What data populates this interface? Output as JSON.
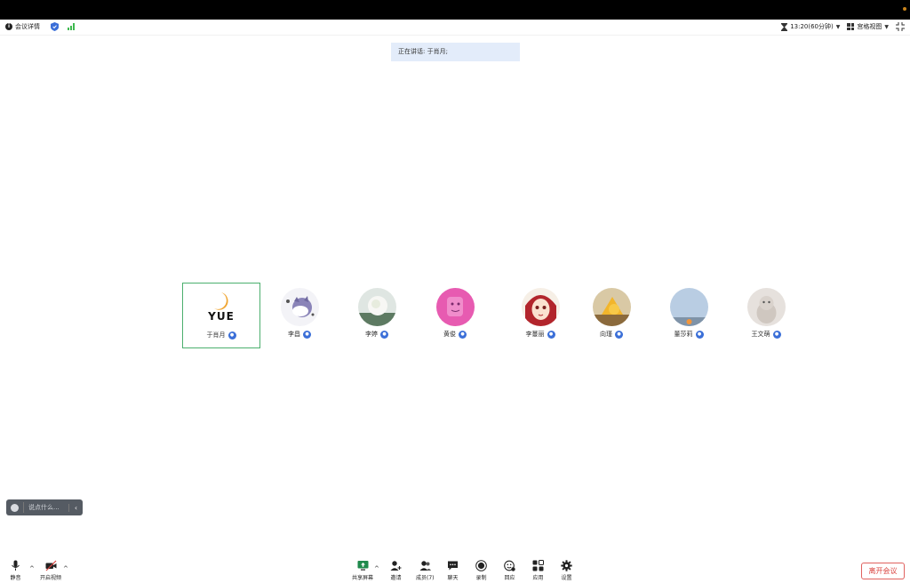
{
  "topbar": {
    "meeting_info_label": "会议详情",
    "timer_label": "13:20(60分钟)",
    "view_label": "宫格视图"
  },
  "banner": {
    "speaking_text": "正在讲话: 于肖月;"
  },
  "participants": [
    {
      "name": "于肖月",
      "logo_text": "YUE"
    },
    {
      "name": "李昌"
    },
    {
      "name": "李婷"
    },
    {
      "name": "黄俊"
    },
    {
      "name": "李蔓丽"
    },
    {
      "name": "向瑾"
    },
    {
      "name": "董莎莉"
    },
    {
      "name": "王文萌"
    }
  ],
  "chat": {
    "placeholder": "说点什么..."
  },
  "toolbar": {
    "mute_label": "静音",
    "video_label": "开启视频",
    "share_label": "共享屏幕",
    "invite_label": "邀请",
    "members_label": "成员(7)",
    "chat_label": "聊天",
    "record_label": "录制",
    "reaction_label": "回应",
    "apps_label": "应用",
    "settings_label": "设置",
    "leave_label": "离开会议"
  },
  "colors": {
    "accent_blue": "#3b6fd8",
    "active_tile_border": "#4caf6e",
    "leave_red": "#d9433f",
    "banner_bg": "#e3ecfa"
  }
}
